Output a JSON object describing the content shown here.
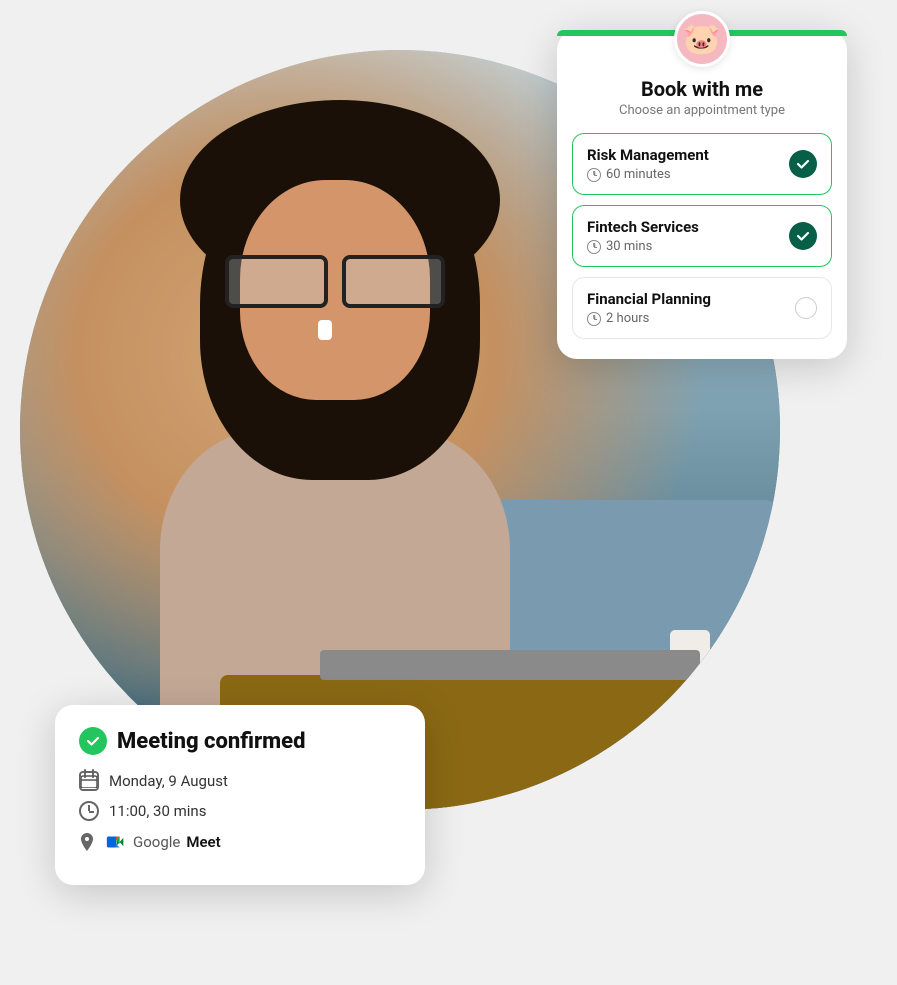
{
  "booking_card": {
    "title": "Book with me",
    "subtitle": "Choose an appointment type",
    "appointments": [
      {
        "id": "risk-management",
        "name": "Risk Management",
        "duration": "60 minutes",
        "selected": true
      },
      {
        "id": "fintech-services",
        "name": "Fintech Services",
        "duration": "30 mins",
        "selected": true
      },
      {
        "id": "financial-planning",
        "name": "Financial Planning",
        "duration": "2 hours",
        "selected": false
      }
    ]
  },
  "meeting_card": {
    "title": "Meeting confirmed",
    "date": "Monday, 9 August",
    "time": "11:00, 30 mins",
    "platform": "Google Meet"
  },
  "colors": {
    "green": "#22c55e",
    "dark_green": "#065f46",
    "border_selected": "#22c55e",
    "border_unselected": "#e5e7eb"
  }
}
